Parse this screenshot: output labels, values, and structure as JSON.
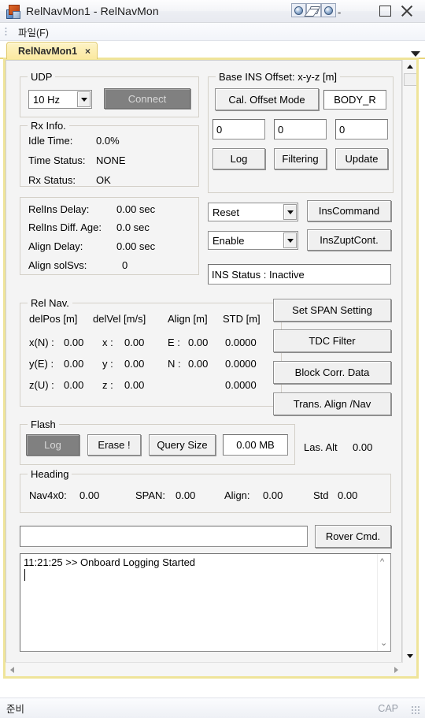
{
  "window": {
    "title": "RelNavMon1 - RelNavMon",
    "app_icon": "app-icon",
    "mdi_restore_icon": "mdi-restore-icon",
    "mdi_minimize_icon": "mdi-minimize-icon",
    "mdi_close_icon": "mdi-close-icon",
    "minimize_dash": "-",
    "maximize_icon": "maximize-icon",
    "close_icon": "close-icon"
  },
  "menubar": {
    "items": [
      {
        "label": "파일(F)"
      }
    ]
  },
  "tabstrip": {
    "tabs": [
      {
        "label": "RelNavMon1",
        "close": "×"
      }
    ],
    "overflow_icon": "tab-overflow-icon"
  },
  "udp": {
    "title": "UDP",
    "rate": "10 Hz",
    "connect_label": "Connect"
  },
  "rx_info": {
    "title": "Rx Info.",
    "rows": [
      {
        "label": "Idle Time:",
        "value": "0.0%"
      },
      {
        "label": "Time Status:",
        "value": "NONE"
      },
      {
        "label": "Rx Status:",
        "value": "OK"
      }
    ]
  },
  "delays": {
    "rows": [
      {
        "label": "RelIns Delay:",
        "value": "0.00 sec"
      },
      {
        "label": "RelIns Diff. Age:",
        "value": "0.0 sec"
      },
      {
        "label": "Align Delay:",
        "value": "0.00 sec"
      },
      {
        "label": "Align solSvs:",
        "value": "0"
      }
    ]
  },
  "rel_nav": {
    "title": "Rel Nav.",
    "headers": [
      "delPos [m]",
      "delVel [m/s]",
      "Align [m]",
      "STD [m]"
    ],
    "rows": [
      {
        "pos_label": "x(N) :",
        "pos": "0.00",
        "vel_label": "x :",
        "vel": "0.00",
        "align_label": "E :",
        "align": "0.00",
        "std": "0.0000"
      },
      {
        "pos_label": "y(E) :",
        "pos": "0.00",
        "vel_label": "y :",
        "vel": "0.00",
        "align_label": "N :",
        "align": "0.00",
        "std": "0.0000"
      },
      {
        "pos_label": "z(U) :",
        "pos": "0.00",
        "vel_label": "z :",
        "vel": "0.00",
        "align_label": "",
        "align": "",
        "std": "0.0000"
      }
    ]
  },
  "base_ins_offset": {
    "title": "Base INS Offset: x-y-z [m]",
    "cal_offset_mode_label": "Cal. Offset Mode",
    "frame_value": "BODY_R",
    "offset_x": "0",
    "offset_y": "0",
    "offset_z": "0",
    "log_label": "Log",
    "filtering_label": "Filtering",
    "update_label": "Update"
  },
  "ins_controls": {
    "command_select": "Reset",
    "command_button": "InsCommand",
    "zupt_select": "Enable",
    "zupt_button": "InsZuptCont.",
    "status_text": "INS Status : Inactive"
  },
  "side_buttons": [
    {
      "label": "Set SPAN Setting"
    },
    {
      "label": "TDC Filter"
    },
    {
      "label": "Block Corr. Data"
    },
    {
      "label": "Trans. Align /Nav"
    }
  ],
  "flash": {
    "title": "Flash",
    "log_label": "Log",
    "erase_label": "Erase !",
    "query_size_label": "Query Size",
    "size_value": "0.00 MB"
  },
  "las_alt": {
    "label": "Las. Alt",
    "value": "0.00"
  },
  "heading": {
    "title": "Heading",
    "fields": [
      {
        "label": "Nav4x0:",
        "value": "0.00"
      },
      {
        "label": "SPAN:",
        "value": "0.00"
      },
      {
        "label": "Align:",
        "value": "0.00"
      },
      {
        "label": "Std",
        "value": "0.00"
      }
    ]
  },
  "command": {
    "input_value": "",
    "input_placeholder": "",
    "rover_cmd_label": "Rover Cmd."
  },
  "log": {
    "lines": [
      "11:21:25 >> Onboard Logging Started"
    ],
    "scroll_up_icon": "scroll-up-icon",
    "scroll_down_icon": "scroll-down-icon"
  },
  "statusbar": {
    "ready_text": "준비",
    "cap_text": "CAP",
    "resize_grip": "resize-grip-icon"
  },
  "colors": {
    "tab_accent": "#efe49a",
    "form_bg": "#f4f4f4",
    "button_face": "#f0f0f0",
    "pressed_button": "#808080"
  }
}
